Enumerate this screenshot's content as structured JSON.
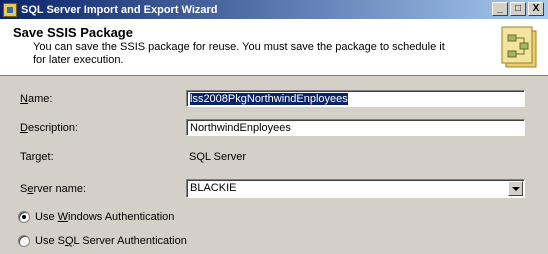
{
  "window": {
    "title": "SQL Server Import and Export Wizard",
    "controls": {
      "minimize": "_",
      "maximize": "□",
      "close": "X"
    }
  },
  "header": {
    "title": "Save SSIS Package",
    "description": "You can save the SSIS package for reuse. You must save the package to schedule it for later execution."
  },
  "form": {
    "name": {
      "label_mnemonic": "N",
      "label_rest": "ame:",
      "value": "lss2008PkgNorthwindEnployees"
    },
    "description": {
      "label_mnemonic": "D",
      "label_rest": "escription:",
      "value": "NorthwindEnployees"
    },
    "target": {
      "label": "Target:",
      "value": "SQL Server"
    },
    "server": {
      "label_pre": "S",
      "label_mnemonic": "e",
      "label_rest": "rver name:",
      "value": "BLACKIE"
    },
    "auth": {
      "windows": {
        "pre": "Use ",
        "mnemonic": "W",
        "rest": "indows Authentication",
        "checked": true
      },
      "sql": {
        "pre": "Use S",
        "mnemonic": "Q",
        "rest": "L Server Authentication",
        "checked": false
      }
    }
  }
}
